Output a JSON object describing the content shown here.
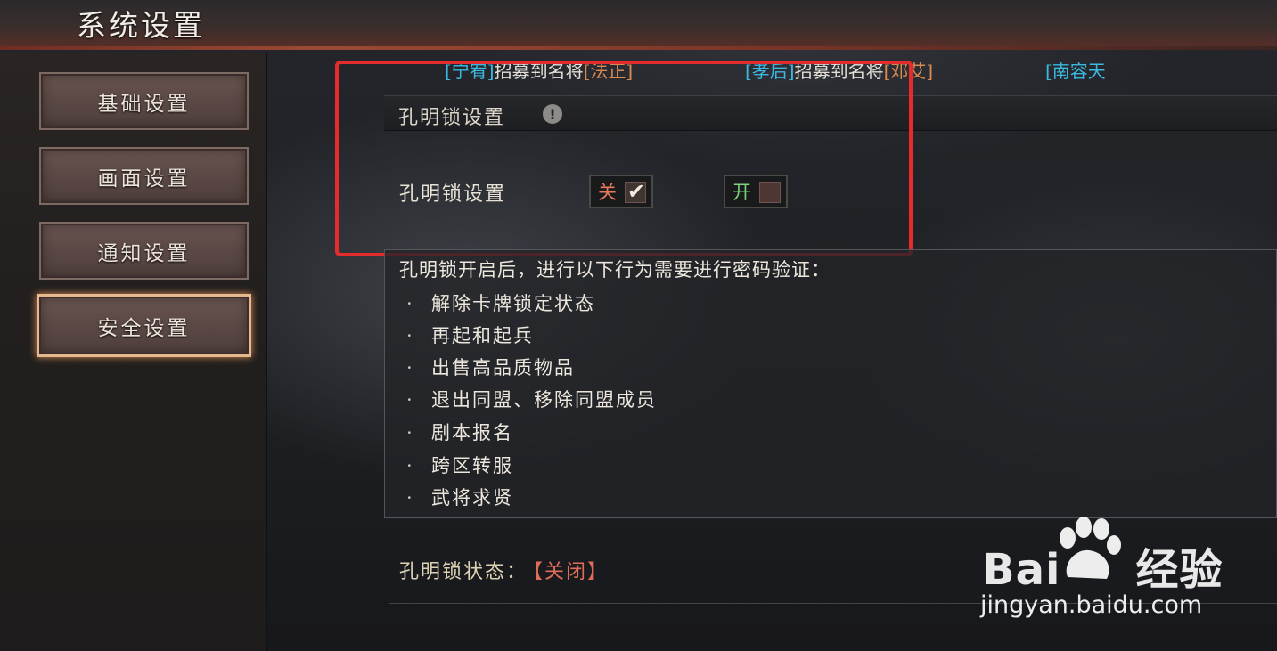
{
  "header": {
    "title": "系统设置"
  },
  "sidebar": {
    "items": [
      {
        "label": "基础设置",
        "active": false
      },
      {
        "label": "画面设置",
        "active": false
      },
      {
        "label": "通知设置",
        "active": false
      },
      {
        "label": "安全设置",
        "active": true
      }
    ]
  },
  "ticker": {
    "entries": [
      {
        "player": "[宁宥]",
        "text": "招募到名将",
        "general": "[法正]"
      },
      {
        "player": "[孝后]",
        "text": "招募到名将",
        "general": "[邓艾]"
      },
      {
        "player": "[南容天",
        "text": "",
        "general": ""
      }
    ]
  },
  "lock_section": {
    "title": "孔明锁设置",
    "info_icon": "info-icon",
    "row_label": "孔明锁设置",
    "off_label": "关",
    "off_checked": true,
    "on_label": "开",
    "on_checked": false
  },
  "description": {
    "intro": "孔明锁开启后，进行以下行为需要进行密码验证：",
    "bullet": "·",
    "items": [
      "解除卡牌锁定状态",
      "再起和起兵",
      "出售高品质物品",
      "退出同盟、移除同盟成员",
      "剧本报名",
      "跨区转服",
      "武将求贤"
    ]
  },
  "status": {
    "label": "孔明锁状态：",
    "value": "【关闭】"
  },
  "watermark": {
    "logo_left": "Bai",
    "logo_right": "经验",
    "url": "jingyan.baidu.com"
  },
  "colors": {
    "highlight_frame": "#e52c2c",
    "active_tab_border": "#e6b88e",
    "player_name": "#3ab8e0",
    "general_name": "#d88a52",
    "off_text": "#e67a5c",
    "on_text": "#7fd07a",
    "status_value": "#e06d5a"
  }
}
